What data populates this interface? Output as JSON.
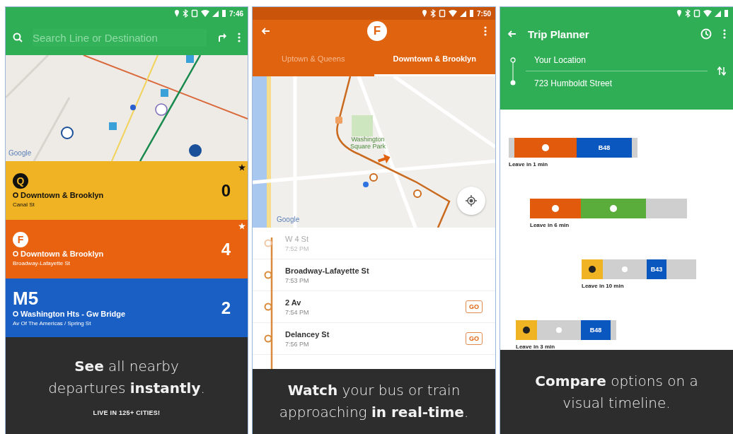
{
  "screens": [
    {
      "status_time": "7:46",
      "search": {
        "placeholder": "Search Line or Destination"
      },
      "map": {
        "attribution": "Google"
      },
      "cards": [
        {
          "route": "Q",
          "kind": "subway",
          "color": "#f0b323",
          "direction": "Downtown & Brooklyn",
          "stop": "Canal St",
          "minutes": "0",
          "favorite": true
        },
        {
          "route": "F",
          "kind": "subway",
          "color": "#e8620f",
          "direction": "Downtown & Brooklyn",
          "stop": "Broadway-Lafayette St",
          "minutes": "4",
          "favorite": true
        },
        {
          "route": "M5",
          "kind": "bus",
          "color": "#1a5fc4",
          "direction": "Washington Hts - Gw Bridge",
          "stop": "Av Of The Americas / Spring St",
          "minutes": "2",
          "favorite": false
        }
      ],
      "caption": "**See** all nearby departures **instantly**.",
      "tagline": "LIVE IN 125+ CITIES!"
    },
    {
      "status_time": "7:50",
      "route": "F",
      "tabs": [
        {
          "label": "Uptown & Queens",
          "selected": false
        },
        {
          "label": "Downtown & Brooklyn",
          "selected": true
        }
      ],
      "map": {
        "park_label": "Washington Square Park",
        "attribution": "Google"
      },
      "stops": [
        {
          "name": "W 4 St",
          "time": "7:52 PM",
          "passed": true
        },
        {
          "name": "Broadway-Lafayette St",
          "time": "7:53 PM",
          "passed": false
        },
        {
          "name": "2 Av",
          "time": "7:54 PM",
          "passed": false,
          "action": "GO"
        },
        {
          "name": "Delancey St",
          "time": "7:56 PM",
          "passed": false,
          "action": "GO"
        }
      ],
      "caption": "**Watch** your bus or train approaching **in real-time**."
    },
    {
      "title": "Trip Planner",
      "origin": "Your Location",
      "destination": "723 Humboldt Street",
      "options": [
        {
          "leave": "Leave in 1 min",
          "segments": [
            {
              "kind": "walk"
            },
            {
              "kind": "subway",
              "color": "#e25b0c"
            },
            {
              "kind": "bus",
              "color": "#0b57c0",
              "label": "B48"
            },
            {
              "kind": "walk"
            }
          ]
        },
        {
          "leave": "Leave in 6 min",
          "segments": [
            {
              "kind": "subway",
              "color": "#e25b0c"
            },
            {
              "kind": "subway",
              "color": "#5aad3a"
            },
            {
              "kind": "walk"
            }
          ]
        },
        {
          "leave": "Leave in 10 min",
          "segments": [
            {
              "kind": "subway",
              "color": "#f0b323"
            },
            {
              "kind": "wait"
            },
            {
              "kind": "bus",
              "color": "#0b57c0",
              "label": "B43"
            },
            {
              "kind": "walk"
            }
          ]
        },
        {
          "leave": "Leave in 3 min",
          "segments": [
            {
              "kind": "subway",
              "color": "#f0b323"
            },
            {
              "kind": "wait"
            },
            {
              "kind": "bus",
              "color": "#0b57c0",
              "label": "B48"
            },
            {
              "kind": "walk"
            }
          ]
        }
      ],
      "caption": "**Compare** options on a visual timeline."
    }
  ]
}
